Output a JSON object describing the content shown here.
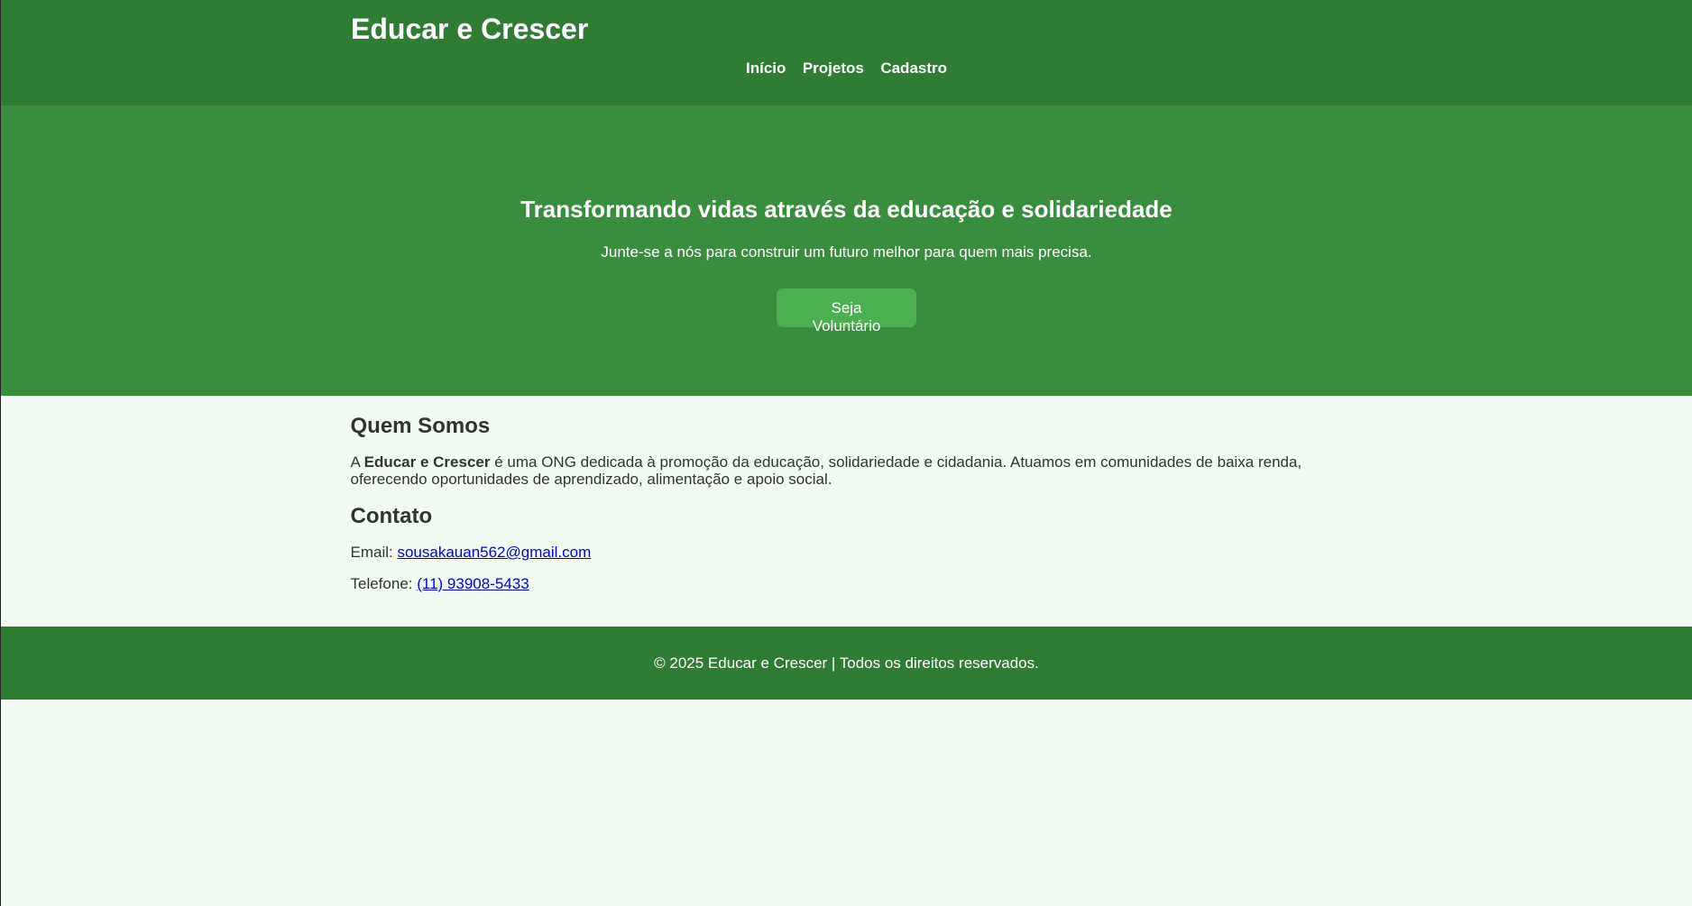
{
  "header": {
    "title": "Educar e Crescer",
    "nav": [
      "Início",
      "Projetos",
      "Cadastro"
    ]
  },
  "hero": {
    "title": "Transformando vidas através da educação e solidariedade",
    "subtitle": "Junte-se a nós para construir um futuro melhor para quem mais precisa.",
    "button": "Seja Voluntário"
  },
  "about": {
    "title": "Quem Somos",
    "prefix": "A ",
    "org": "Educar e Crescer",
    "text": " é uma ONG dedicada à promoção da educação, solidariedade e cidadania. Atuamos em comunidades de baixa renda, oferecendo oportunidades de aprendizado, alimentação e apoio social."
  },
  "contact": {
    "title": "Contato",
    "email_label": "Email: ",
    "email": "sousakauan562@gmail.com",
    "phone_label": "Telefone: ",
    "phone": "(11) 93908-5433"
  },
  "footer": {
    "text": "© 2025 Educar e Crescer | Todos os direitos reservados."
  },
  "colors": {
    "header": "#2e7d32",
    "hero": "#388e3c",
    "button": "#4caf50",
    "background": "#f1fbf2"
  }
}
